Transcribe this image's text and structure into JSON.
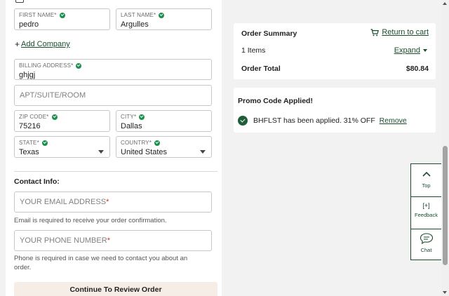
{
  "form": {
    "first_name": {
      "label": "FIRST NAME*",
      "value": "pedro"
    },
    "last_name": {
      "label": "LAST NAME*",
      "value": "Argulles"
    },
    "add_company": {
      "plus": "+",
      "label": "Add Company"
    },
    "billing_address": {
      "label": "BILLING ADDRESS*",
      "value": "ghjgj"
    },
    "apt_suite": {
      "placeholder": "APT/SUITE/ROOM"
    },
    "zip_code": {
      "label": "ZIP CODE*",
      "value": "75216"
    },
    "city": {
      "label": "CITY*",
      "value": "Dallas"
    },
    "state": {
      "label": "STATE*",
      "value": "Texas"
    },
    "country": {
      "label": "COUNTRY*",
      "value": "United States"
    },
    "contact_title": "Contact Info:",
    "email": {
      "placeholder": "YOUR EMAIL ADDRESS",
      "required_mark": "*",
      "hint": "Email is required to receive your order confirmation."
    },
    "phone": {
      "placeholder": "YOUR PHONE NUMBER",
      "required_mark": "*",
      "hint": "Phone is required in case we need to contact you about an order."
    },
    "continue_label": "Continue To Review Order"
  },
  "order_summary": {
    "title": "Order Summary",
    "return_label": "Return to cart",
    "items_text": "1 Items",
    "expand_label": "Expand",
    "total_label": "Order Total",
    "total_value": "$80.84"
  },
  "promo": {
    "title": "Promo Code Applied!",
    "message": "BHFLST has been applied. 31% OFF",
    "remove_label": "Remove"
  },
  "side_widget": {
    "top_label": "Top",
    "feedback_glyph": "[+]",
    "feedback_label": "Feedback",
    "chat_label": "Chat"
  },
  "colors": {
    "brand_green": "#1a4d2e",
    "check_green": "#1f8f4e",
    "button_bg": "#f6ede6",
    "required_red": "#c0392b"
  },
  "icons": [
    "checkbox-icon",
    "check-circle-icon",
    "cart-icon",
    "chevron-down-icon",
    "chevron-up-icon",
    "feedback-icon",
    "chat-icon"
  ]
}
